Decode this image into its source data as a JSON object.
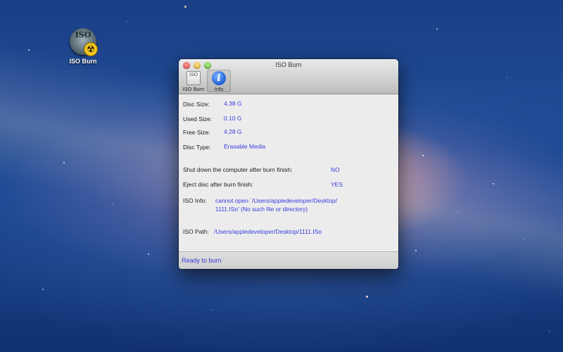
{
  "desktop": {
    "icon_label": "ISO Burn",
    "icon_text": "ISO"
  },
  "window": {
    "title": "ISO Burn",
    "toolbar": {
      "burn_label": "ISO Burn",
      "burn_icon_text": "ISO",
      "info_label": "Info",
      "info_icon_text": "i"
    },
    "fields": {
      "disc_size_label": "Disc Size:",
      "disc_size_value": "4.38 G",
      "used_size_label": "Used Size:",
      "used_size_value": "0.10 G",
      "free_size_label": "Free Size:",
      "free_size_value": "4.28 G",
      "disc_type_label": "Disc Type:",
      "disc_type_value": "Erasable Media",
      "shutdown_label": "Shut down the computer after burn finish:",
      "shutdown_value": "NO",
      "eject_label": "Eject disc after burn finish:",
      "eject_value": "YES",
      "iso_info_label": "ISO Info:",
      "iso_info_line1": "cannot open `/Users/appledeveloper/Desktop/",
      "iso_info_line2": "1111.ISo' (No such file or directory)",
      "iso_path_label": "ISO Path:",
      "iso_path_value": "/Users/appledeveloper/Desktop/1111.ISo"
    },
    "status": "Ready to burn"
  },
  "colors": {
    "value_blue": "#3a3ae0",
    "desktop_blue": "#1b3f86"
  },
  "icons": [
    "close-icon",
    "minimize-icon",
    "zoom-icon",
    "iso-burn-icon",
    "info-icon",
    "radiation-icon"
  ]
}
